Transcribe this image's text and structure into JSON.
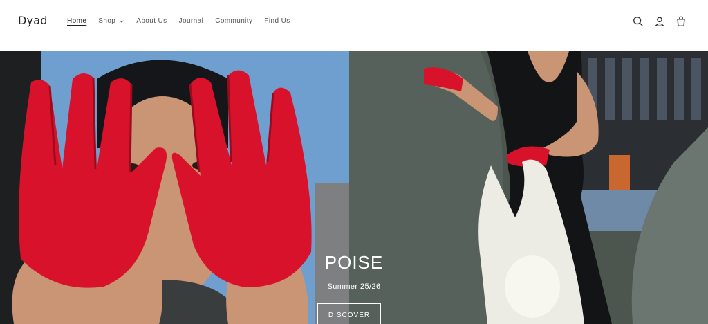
{
  "corner": {
    "selector_glyph": "▾"
  },
  "header": {
    "logo": "Dyad",
    "nav": [
      {
        "label": "Home",
        "active": true
      },
      {
        "label": "Shop",
        "has_dropdown": true
      },
      {
        "label": "About Us"
      },
      {
        "label": "Journal"
      },
      {
        "label": "Community"
      },
      {
        "label": "Find Us"
      }
    ],
    "icons": [
      "search-icon",
      "account-icon",
      "cart-icon"
    ]
  },
  "hero": {
    "title": "POISE",
    "subtitle": "Summer 25/26",
    "cta": "DISCOVER"
  },
  "colors": {
    "glove_red": "#d9122b",
    "sky_blue": "#6f9fcf",
    "stone_gray": "#4d554f",
    "text_dark": "#222222"
  }
}
